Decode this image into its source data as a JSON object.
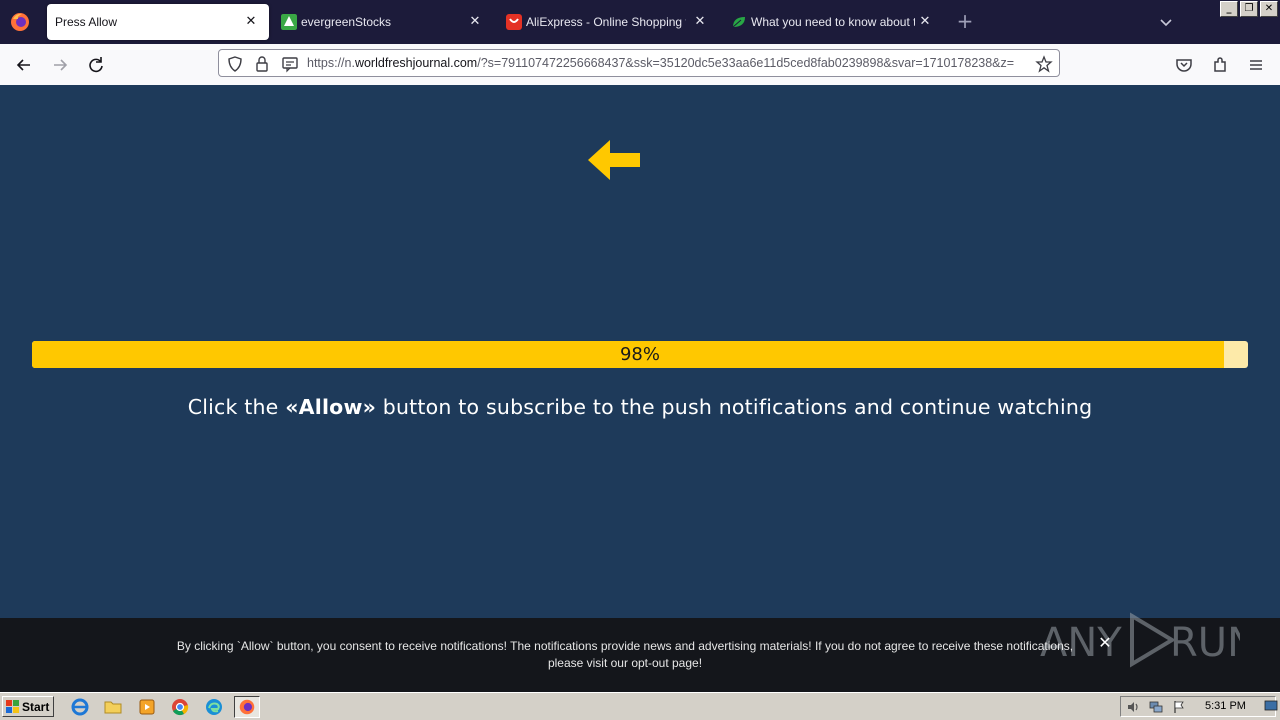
{
  "browser": {
    "tabs": [
      {
        "title": "Press Allow",
        "active": true,
        "favicon": "firefox-page-icon"
      },
      {
        "title": "evergreenStocks",
        "active": false,
        "favicon": "evergreen-icon"
      },
      {
        "title": "AliExpress - Online Shopping for Po",
        "active": false,
        "favicon": "aliexpress-icon"
      },
      {
        "title": "What you need to know about the",
        "active": false,
        "favicon": "leaf-icon"
      }
    ],
    "close_glyph": "✕",
    "new_tab_glyph": "+",
    "window_buttons": {
      "minimize": "_",
      "restore": "❐",
      "close": "✕"
    },
    "url": {
      "prefix": "https://n.",
      "domain": "worldfreshjournal.com",
      "rest": "/?s=791107472256668437&ssk=35120dc5e33aa6e11d5ced8fab0239898&svar=1710178238&z="
    }
  },
  "page": {
    "progress": {
      "percent": 98,
      "label": "98%"
    },
    "headline": {
      "before": "Click the ",
      "bold": "«Allow»",
      "after": " button to subscribe to the push notifications and continue watching"
    },
    "colors": {
      "background": "#1e3a5a",
      "accent": "#ffc800",
      "track": "#fdeaa9"
    }
  },
  "consent": {
    "line1": "By clicking `Allow` button, you consent to receive notifications! The notifications provide news and advertising materials! If you do not agree to receive these notifications,",
    "line2_before": "please visit our ",
    "line2_link": "opt-out page",
    "line2_after": "!",
    "close_glyph": "✕"
  },
  "taskbar": {
    "start_label": "Start",
    "apps": [
      "ie-icon",
      "folder-icon",
      "media-player-icon",
      "chrome-icon",
      "edge-icon",
      "firefox-icon"
    ],
    "clock": "5:31 PM"
  }
}
